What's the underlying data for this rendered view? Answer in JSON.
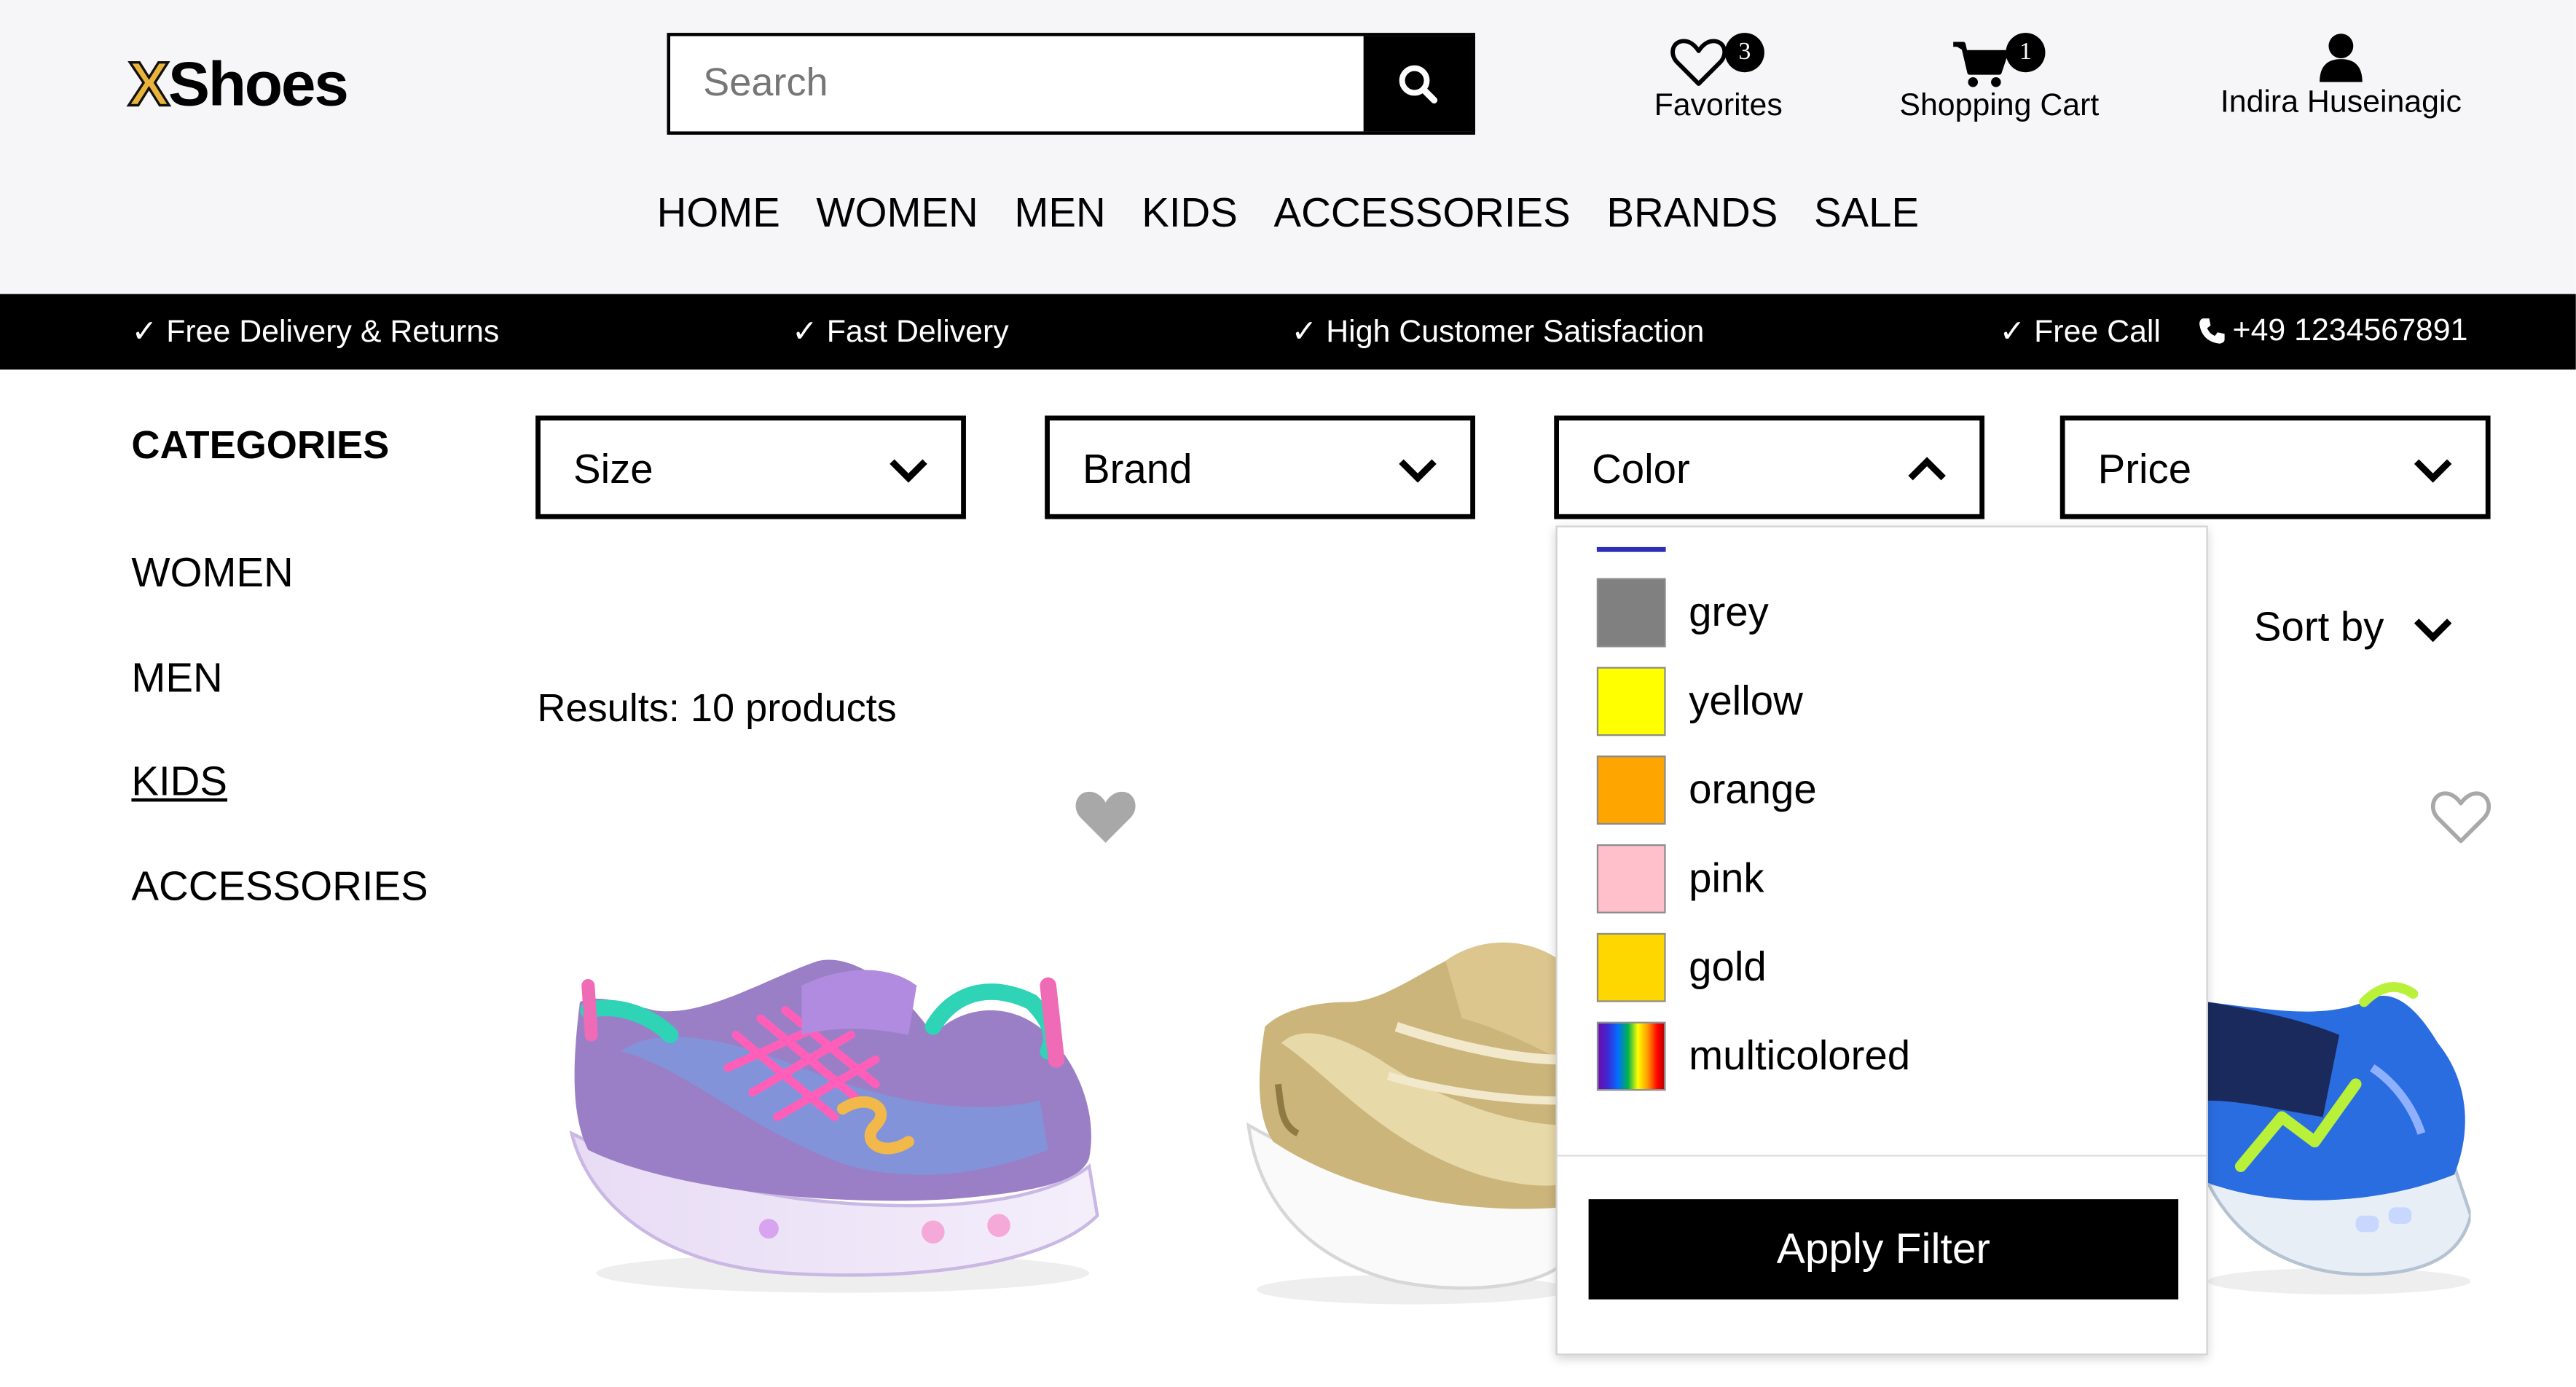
{
  "brand": {
    "logo_x": "X",
    "logo_rest": "Shoes"
  },
  "search": {
    "placeholder": "Search"
  },
  "header_actions": {
    "favorites": {
      "label": "Favorites",
      "count": "3"
    },
    "cart": {
      "label": "Shopping Cart",
      "count": "1"
    },
    "account": {
      "label": "Indira Huseinagic"
    }
  },
  "main_nav": [
    "HOME",
    "WOMEN",
    "MEN",
    "KIDS",
    "ACCESSORIES",
    "BRANDS",
    "SALE"
  ],
  "promo_strip": {
    "items": [
      "✓ Free Delivery & Returns",
      "✓ Fast Delivery",
      "✓ High Customer Satisfaction",
      "✓ Free Call"
    ],
    "phone": "+49 1234567891"
  },
  "sidebar": {
    "title": "CATEGORIES",
    "items": [
      "WOMEN",
      "MEN",
      "KIDS",
      "ACCESSORIES"
    ],
    "active": "KIDS"
  },
  "filters": {
    "size": "Size",
    "brand": "Brand",
    "color": "Color",
    "price": "Price"
  },
  "results_text": "Results: 10 products",
  "sort_label": "Sort by",
  "color_dropdown": {
    "options": [
      {
        "name": "grey",
        "hex": "#808080"
      },
      {
        "name": "yellow",
        "hex": "#ffff00"
      },
      {
        "name": "orange",
        "hex": "#ffa500"
      },
      {
        "name": "pink",
        "hex": "#ffc0cb"
      },
      {
        "name": "gold",
        "hex": "#ffd700"
      },
      {
        "name": "multicolored",
        "hex": "rainbow"
      }
    ],
    "apply_label": "Apply Filter"
  },
  "products": [
    {
      "favorited": true
    },
    {
      "favorited": false
    },
    {
      "favorited": false
    }
  ]
}
